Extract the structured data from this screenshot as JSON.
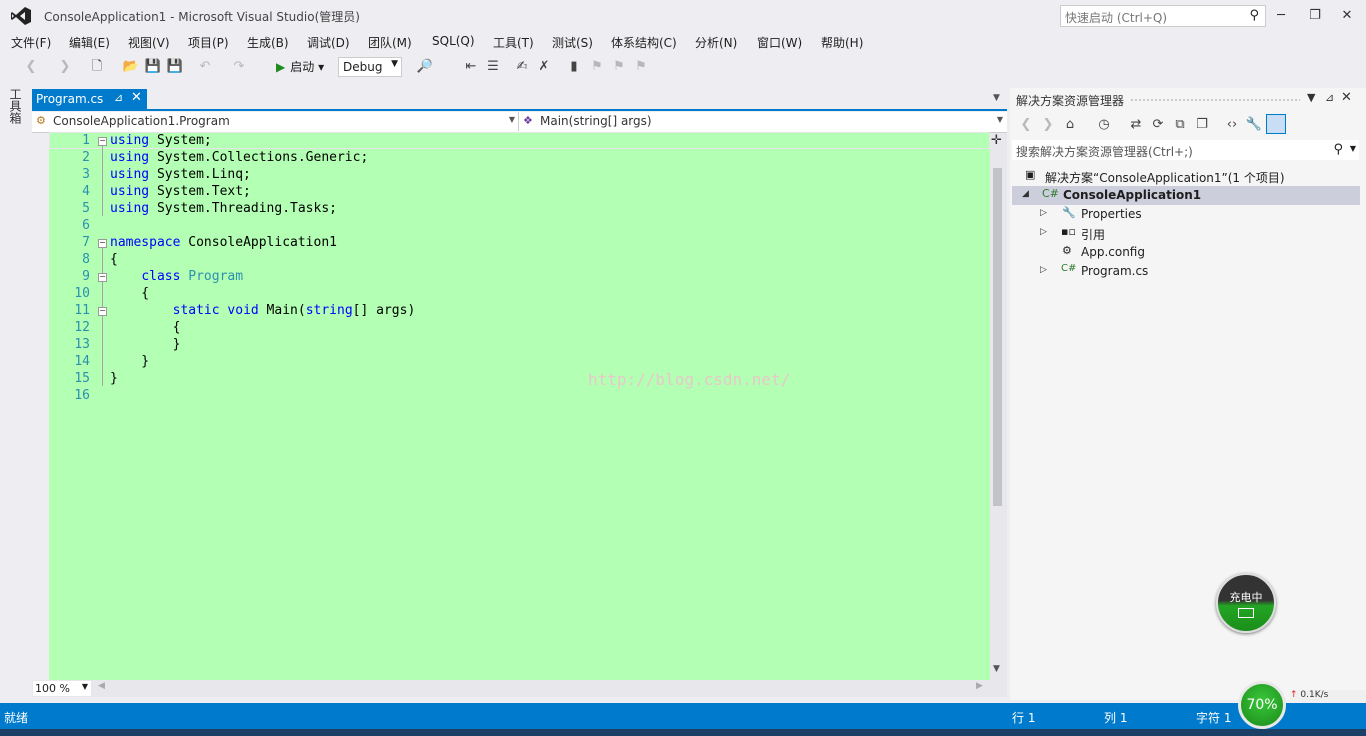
{
  "window": {
    "title": "ConsoleApplication1 - Microsoft Visual Studio(管理员)",
    "quick_launch_placeholder": "快速启动 (Ctrl+Q)"
  },
  "menu": [
    "文件(F)",
    "编辑(E)",
    "视图(V)",
    "项目(P)",
    "生成(B)",
    "调试(D)",
    "团队(M)",
    "SQL(Q)",
    "工具(T)",
    "测试(S)",
    "体系结构(C)",
    "分析(N)",
    "窗口(W)",
    "帮助(H)"
  ],
  "toolbar": {
    "start_label": "启动",
    "configuration": "Debug"
  },
  "toolbox_label": "工具箱",
  "editor": {
    "tab_label": "Program.cs",
    "nav_class": "ConsoleApplication1.Program",
    "nav_member": "Main(string[] args)",
    "zoom": "100 %",
    "line_numbers": [
      "1",
      "2",
      "3",
      "4",
      "5",
      "6",
      "7",
      "8",
      "9",
      "10",
      "11",
      "12",
      "13",
      "14",
      "15",
      "16"
    ],
    "background_color": "#b3ffb3",
    "watermark": "http://blog.csdn.net/"
  },
  "solution_explorer": {
    "title": "解决方案资源管理器",
    "search_placeholder": "搜索解决方案资源管理器(Ctrl+;)",
    "solution_label": "解决方案“ConsoleApplication1”(1 个项目)",
    "project_label": "ConsoleApplication1",
    "items": [
      "Properties",
      "引用",
      "App.config",
      "Program.cs"
    ]
  },
  "charge_widget": {
    "label": "充电中"
  },
  "status": {
    "text": "就绪",
    "row": "行 1",
    "col": "列 1",
    "char": "字符 1"
  },
  "tray": {
    "battery_percent": "70%",
    "net_speed": "0.1K/s"
  },
  "colors": {
    "accent": "#007acc",
    "keyword": "#0000ff",
    "type": "#2b91af"
  }
}
